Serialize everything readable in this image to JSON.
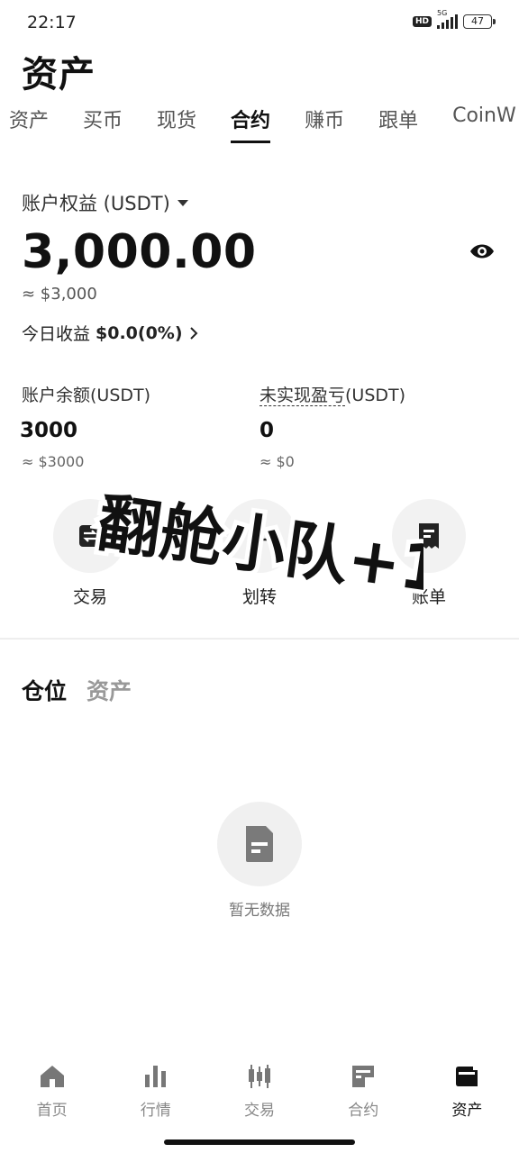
{
  "status": {
    "time": "22:17",
    "hd": "HD",
    "network": "5G",
    "battery": "47"
  },
  "page_title": "资产",
  "tabs": [
    "资产",
    "买币",
    "现货",
    "合约",
    "赚币",
    "跟单",
    "CoinW"
  ],
  "active_tab_index": 3,
  "account": {
    "equity_label": "账户权益 (USDT)",
    "equity_value": "3,000.00",
    "equity_approx": "≈ $3,000",
    "today_label": "今日收益",
    "today_value": "$0.0(0%)",
    "balance_label": "账户余额(USDT)",
    "balance_value": "3000",
    "balance_approx": "≈ $3000",
    "unrealized_label_underlined": "未实现盈亏",
    "unrealized_label_suffix": "(USDT)",
    "unrealized_value": "0",
    "unrealized_approx": "≈ $0"
  },
  "actions": [
    {
      "label": "交易",
      "icon": "swap-icon"
    },
    {
      "label": "划转",
      "icon": "transfer-icon"
    },
    {
      "label": "账单",
      "icon": "bill-icon"
    }
  ],
  "sticker_text": "翻舱小队+1",
  "sub_tabs": [
    "仓位",
    "资产"
  ],
  "empty_text": "暂无数据",
  "bottom_nav": [
    {
      "label": "首页",
      "icon": "home-icon"
    },
    {
      "label": "行情",
      "icon": "chart-icon"
    },
    {
      "label": "交易",
      "icon": "candlestick-icon"
    },
    {
      "label": "合约",
      "icon": "contract-icon"
    },
    {
      "label": "资产",
      "icon": "wallet-icon"
    }
  ],
  "active_nav_index": 4,
  "colors": {
    "text": "#111111",
    "muted": "#888888",
    "icon_gray": "#777777",
    "circle_bg": "#f2f2f2"
  }
}
